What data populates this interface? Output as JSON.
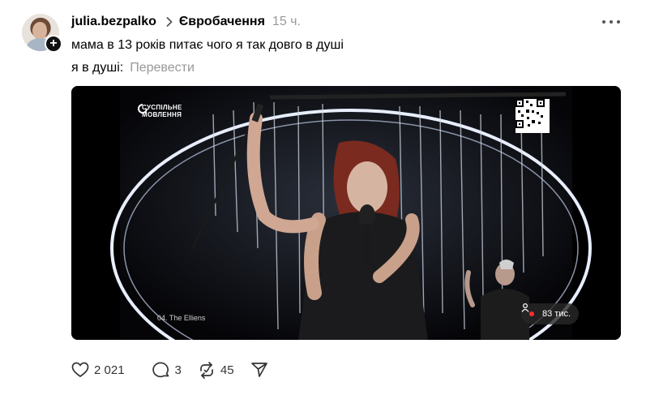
{
  "post": {
    "username": "julia.bezpalko",
    "topic": "Євробачення",
    "time": "15 ч.",
    "text_line1": "мама в 13 років питає чого я так довго в душі",
    "text_line2": "я в душі:",
    "translate": "Перевести"
  },
  "video": {
    "broadcaster": "СУСПІЛЬНЕ МОВЛЕННЯ",
    "act_label": "04. The Elliens",
    "viewers": "83 тис."
  },
  "actions": {
    "likes": "2 021",
    "comments": "3",
    "reposts": "45"
  },
  "colors": {
    "muted_text": "#999999",
    "live_dot": "#ff2d2d"
  }
}
